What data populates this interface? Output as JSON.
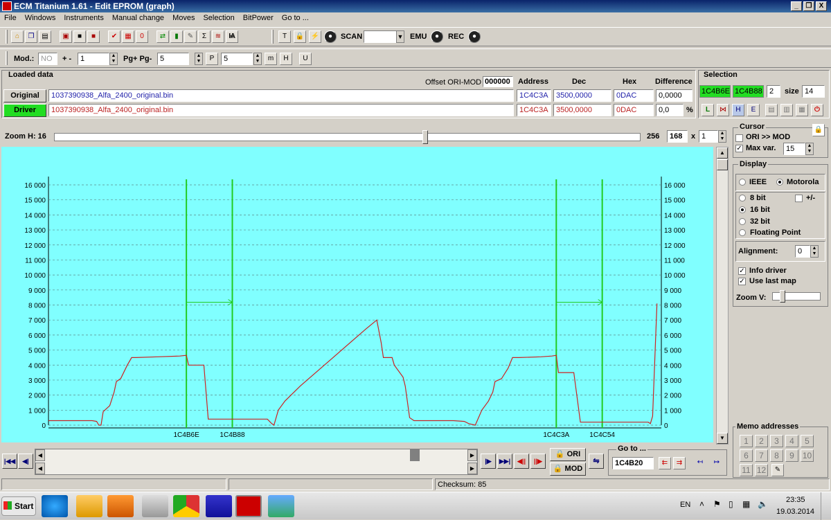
{
  "window": {
    "title": "ECM Titanium 1.61 - Edit EPROM (graph)",
    "min": "_",
    "restore": "❐",
    "close": "X"
  },
  "menu": [
    "File",
    "Windows",
    "Instruments",
    "Manual change",
    "Moves",
    "Selection",
    "BitPower",
    "Go to ..."
  ],
  "toolbar1": {
    "scan_label": "SCAN",
    "emu_label": "EMU",
    "rec_label": "REC",
    "scan_value": ""
  },
  "toolbar2": {
    "mod_label": "Mod.:",
    "mod_value": "NO",
    "plusminus_label": "+ -",
    "plusminus_value": "1",
    "pg_label": "Pg+ Pg-",
    "pg_value": "5",
    "p_value": "5"
  },
  "loaded": {
    "title": "Loaded data",
    "offset_label": "Offset ORI-MOD",
    "offset_value": "000000",
    "col_address": "Address",
    "col_dec": "Dec",
    "col_hex": "Hex",
    "col_diff": "Difference",
    "original_btn": "Original",
    "original_file": "1037390938_Alfa_2400_original.bin",
    "original_address": "1C4C3A",
    "original_dec": "3500,0000",
    "original_hex": "0DAC",
    "original_diff": "0,0000",
    "driver_btn": "Driver",
    "driver_file": "1037390938_Alfa_2400_original.bin",
    "driver_address": "1C4C3A",
    "driver_dec": "3500,0000",
    "driver_hex": "0DAC",
    "driver_diff": "0,0",
    "pct": "%"
  },
  "selection": {
    "title": "Selection",
    "start": "1C4B6E",
    "end": "1C4B88",
    "count": "2",
    "size_label": "size",
    "size_value": "14"
  },
  "zoom": {
    "label": "Zoom H: 16",
    "value_256": "256",
    "value_168": "168",
    "x_label": "x",
    "x_value": "1"
  },
  "cursor": {
    "title": "Cursor",
    "ori_mod": "ORI >> MOD",
    "ori_mod_checked": false,
    "max_var": "Max var.",
    "max_var_checked": true,
    "max_var_value": "15"
  },
  "display": {
    "title": "Display",
    "ieee": "IEEE",
    "motorola": "Motorola",
    "bit8": "8 bit",
    "plusminus": "+/-",
    "bit16": "16 bit",
    "bit32": "32 bit",
    "float": "Floating Point",
    "alignment_label": "Alignment:",
    "alignment_value": "0",
    "info_driver": "Info driver",
    "use_last_map": "Use last map",
    "zoom_v": "Zoom V:"
  },
  "memo": {
    "title": "Memo addresses",
    "numbers": [
      "1",
      "2",
      "3",
      "4",
      "5",
      "6",
      "7",
      "8",
      "9",
      "10",
      "11",
      "12"
    ]
  },
  "bottom": {
    "ori_btn": "ORI",
    "mod_btn": "MOD",
    "goto_title": "Go to ...",
    "goto_value": "1C4B20",
    "checksum": "Checksum: 85"
  },
  "taskbar": {
    "start": "Start",
    "lang": "EN",
    "time": "23:35",
    "date": "19.03.2014"
  },
  "chart_data": {
    "type": "line",
    "ylim": [
      0,
      16000
    ],
    "yticks": [
      "0",
      "1 000",
      "2 000",
      "3 000",
      "4 000",
      "5 000",
      "6 000",
      "7 000",
      "8 000",
      "9 000",
      "10 000",
      "11 000",
      "12 000",
      "13 000",
      "14 000",
      "15 000",
      "16 000"
    ],
    "markers": [
      {
        "label": "1C4B6E",
        "index": 63
      },
      {
        "label": "1C4B88",
        "index": 84
      },
      {
        "label": "1C4C3A",
        "index": 232
      },
      {
        "label": "1C4C54",
        "index": 253
      }
    ],
    "arrows": [
      [
        63,
        84
      ],
      [
        232,
        253
      ]
    ],
    "series": [
      {
        "color": "#cc2222",
        "points": [
          [
            0,
            300
          ],
          [
            20,
            300
          ],
          [
            22,
            250
          ],
          [
            23,
            0
          ],
          [
            24,
            0
          ],
          [
            25,
            900
          ],
          [
            28,
            1300
          ],
          [
            30,
            2200
          ],
          [
            31,
            2900
          ],
          [
            33,
            3100
          ],
          [
            36,
            4000
          ],
          [
            38,
            4500
          ],
          [
            40,
            4500
          ],
          [
            50,
            4550
          ],
          [
            60,
            4600
          ],
          [
            63,
            4650
          ],
          [
            64,
            4000
          ],
          [
            71,
            4000
          ],
          [
            73,
            400
          ],
          [
            82,
            400
          ],
          [
            100,
            400
          ],
          [
            102,
            100
          ],
          [
            103,
            0
          ],
          [
            105,
            1000
          ],
          [
            108,
            1600
          ],
          [
            115,
            2600
          ],
          [
            130,
            4500
          ],
          [
            145,
            6400
          ],
          [
            150,
            7000
          ],
          [
            152,
            5500
          ],
          [
            153,
            4500
          ],
          [
            157,
            4500
          ],
          [
            158,
            4000
          ],
          [
            162,
            3200
          ],
          [
            163,
            2600
          ],
          [
            165,
            500
          ],
          [
            167,
            300
          ],
          [
            175,
            300
          ],
          [
            185,
            300
          ],
          [
            190,
            250
          ],
          [
            192,
            100
          ],
          [
            195,
            0
          ],
          [
            198,
            1000
          ],
          [
            201,
            1600
          ],
          [
            203,
            2200
          ],
          [
            204,
            2900
          ],
          [
            207,
            3100
          ],
          [
            210,
            3800
          ],
          [
            212,
            4500
          ],
          [
            215,
            4500
          ],
          [
            225,
            4550
          ],
          [
            230,
            4600
          ],
          [
            232,
            4650
          ],
          [
            233,
            3500
          ],
          [
            240,
            3500
          ],
          [
            243,
            200
          ],
          [
            252,
            200
          ],
          [
            265,
            200
          ],
          [
            270,
            200
          ],
          [
            274,
            200
          ],
          [
            275,
            100
          ],
          [
            276,
            600
          ],
          [
            278,
            8100
          ]
        ]
      }
    ]
  }
}
